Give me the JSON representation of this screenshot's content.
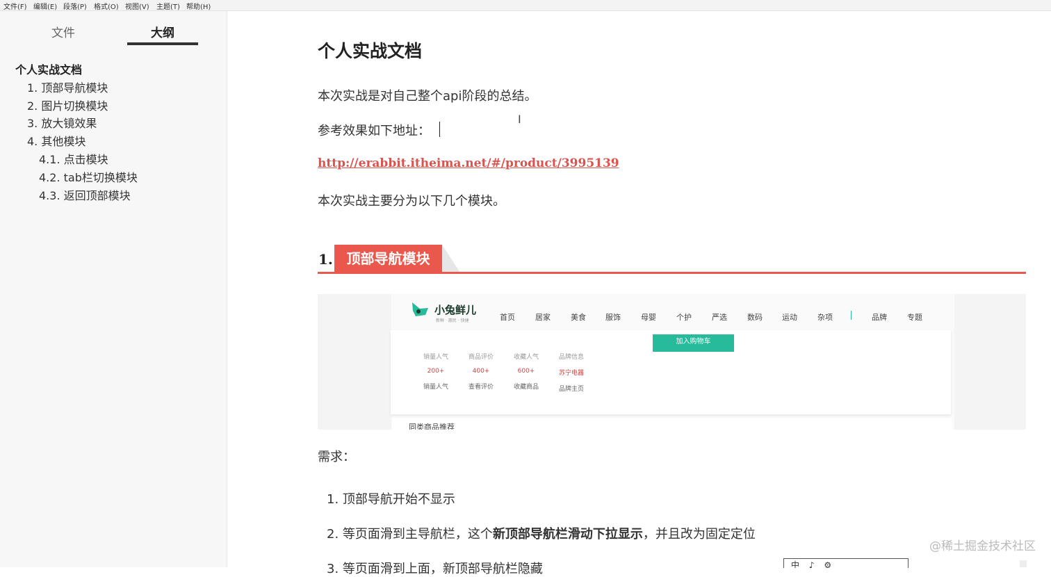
{
  "menubar": [
    "文件(F)",
    "编辑(E)",
    "段落(P)",
    "格式(O)",
    "视图(V)",
    "主题(T)",
    "帮助(H)"
  ],
  "sidebar": {
    "tabs": [
      "文件",
      "大纲"
    ],
    "outline": [
      "个人实战文档",
      "1. 顶部导航模块",
      "2. 图片切换模块",
      "3. 放大镜效果",
      "4. 其他模块",
      "4.1. 点击模块",
      "4.2. tab栏切换模块",
      "4.3. 返回顶部模块"
    ]
  },
  "doc": {
    "title": "个人实战文档",
    "intro": "本次实战是对自己整个api阶段的总结。",
    "ref": "参考效果如下地址：",
    "link": "http://erabbit.itheima.net/#/product/3995139",
    "modules_intro": "本次实战主要分为以下几个模块。",
    "section1_num": "1.",
    "section1_title": "顶部导航模块",
    "req_label": "需求：",
    "req1": "1. 顶部导航开始不显示",
    "req2_pre": "2. 等页面滑到主导航栏，这个",
    "req2_bold": "新顶部导航栏滑动下拉显示",
    "req2_post": "，并且改为固定定位",
    "req3": "3. 等页面滑到上面，新顶部导航栏隐藏"
  },
  "screenshot": {
    "logo": "小兔鲜儿",
    "logo_sub": "新鲜 · 惠民 · 快捷",
    "nav": [
      "首页",
      "居家",
      "美食",
      "服饰",
      "母婴",
      "个护",
      "严选",
      "数码",
      "运动",
      "杂项",
      "品牌",
      "专题"
    ],
    "cart_button": "加入购物车",
    "stats": [
      {
        "label": "销量人气",
        "value": "200+",
        "action": "销量人气"
      },
      {
        "label": "商品评价",
        "value": "400+",
        "action": "查看评价"
      },
      {
        "label": "收藏人气",
        "value": "600+",
        "action": "收藏商品"
      },
      {
        "label": "品牌信息",
        "value": "苏宁电器",
        "action": "品牌主页"
      }
    ],
    "bottom_text": "同类商品推荐"
  },
  "watermark": "@稀土掘金技术社区",
  "toolbox": [
    "中",
    "♪",
    "⚙"
  ],
  "colors": {
    "accent_red": "#e9574d",
    "link_red": "#d9534f",
    "green": "#27ba9b"
  }
}
